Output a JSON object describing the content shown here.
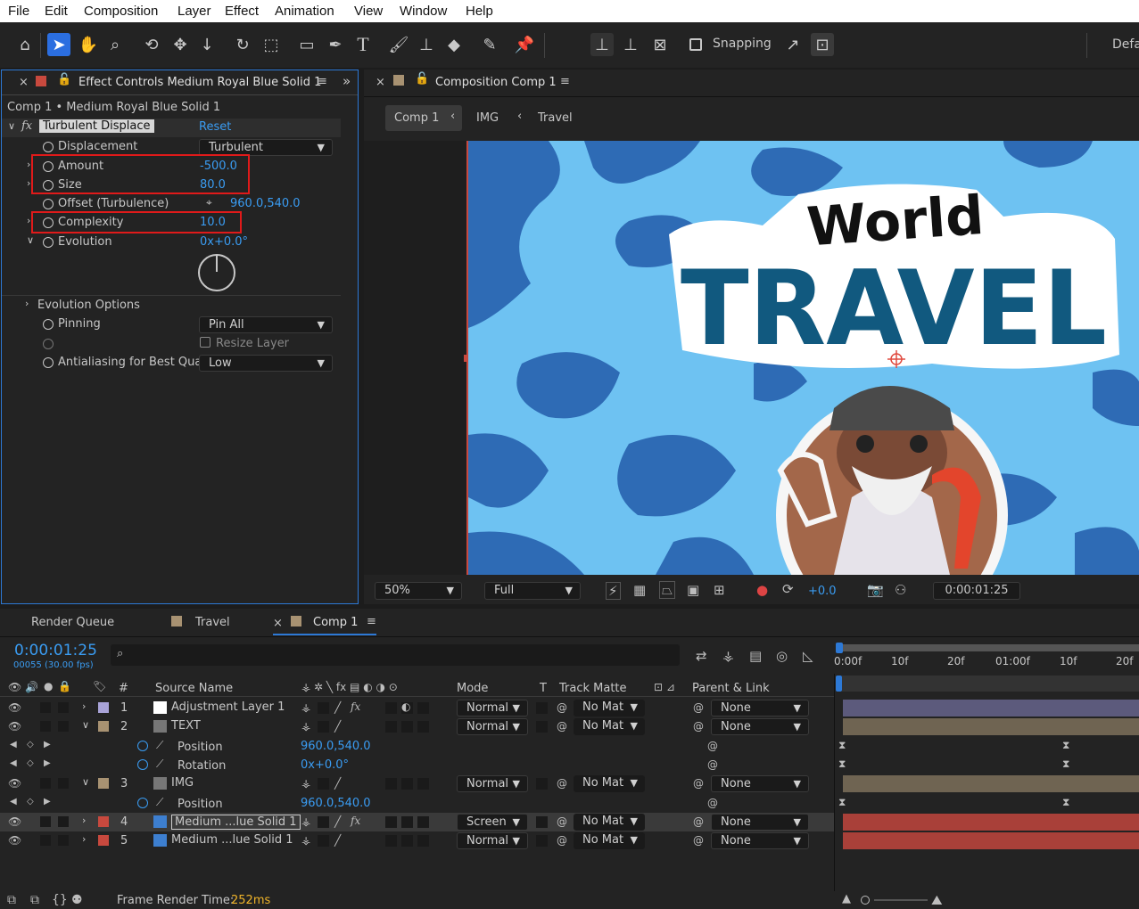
{
  "menu": [
    "File",
    "Edit",
    "Composition",
    "Layer",
    "Effect",
    "Animation",
    "View",
    "Window",
    "Help"
  ],
  "toolbar": {
    "snapping": "Snapping",
    "workspace": "Defa"
  },
  "effect_panel": {
    "tab_title": "Effect Controls Medium Royal Blue Solid 1",
    "breadcrumb": "Comp 1 • Medium Royal Blue Solid 1",
    "effect_name": "Turbulent Displace",
    "reset": "Reset",
    "props": {
      "displacement": {
        "label": "Displacement",
        "value": "Turbulent"
      },
      "amount": {
        "label": "Amount",
        "value": "-500.0"
      },
      "size": {
        "label": "Size",
        "value": "80.0"
      },
      "offset": {
        "label": "Offset (Turbulence)",
        "value": "960.0,540.0"
      },
      "complexity": {
        "label": "Complexity",
        "value": "10.0"
      },
      "evolution": {
        "label": "Evolution",
        "value": "0x+0.0°"
      },
      "evolution_options": {
        "label": "Evolution Options"
      },
      "pinning": {
        "label": "Pinning",
        "value": "Pin All"
      },
      "resize": {
        "label": "Resize Layer"
      },
      "antialias": {
        "label": "Antialiasing for Best Qual",
        "value": "Low"
      }
    }
  },
  "comp_panel": {
    "tab_title": "Composition Comp 1",
    "crumbs": [
      "Comp 1",
      "IMG",
      "Travel"
    ],
    "artwork": {
      "line1": "World",
      "line2": "TRAVEL"
    },
    "zoom": "50%",
    "quality": "Full",
    "exposure": "+0.0",
    "timecode": "0:00:01:25"
  },
  "timeline": {
    "tabs": [
      "Render Queue",
      "Travel",
      "Comp 1"
    ],
    "timecode": "0:00:01:25",
    "frames": "00055 (30.00 fps)",
    "search_placeholder": "",
    "ruler": [
      "0:00f",
      "10f",
      "20f",
      "01:00f",
      "10f",
      "20f"
    ],
    "headers": {
      "num": "#",
      "source": "Source Name",
      "mode": "Mode",
      "t": "T",
      "matte": "Track Matte",
      "parent": "Parent & Link"
    },
    "layers": [
      {
        "num": "1",
        "name": "Adjustment Layer 1",
        "mode": "Normal",
        "matte": "No Mat",
        "parent": "None",
        "color": "#a9a3d8",
        "bar": "#5c5a7c"
      },
      {
        "num": "2",
        "name": "TEXT",
        "mode": "Normal",
        "matte": "No Mat",
        "parent": "None",
        "color": "#a89272",
        "bar": "#6f6452"
      },
      {
        "prop": "Position",
        "value": "960.0,540.0"
      },
      {
        "prop": "Rotation",
        "value": "0x+0.0°"
      },
      {
        "num": "3",
        "name": "IMG",
        "mode": "Normal",
        "matte": "No Mat",
        "parent": "None",
        "color": "#a89272",
        "bar": "#6f6452"
      },
      {
        "prop": "Position",
        "value": "960.0,540.0"
      },
      {
        "num": "4",
        "name": "Medium ...lue Solid 1",
        "mode": "Screen",
        "matte": "No Mat",
        "parent": "None",
        "color": "#c8493e",
        "bar": "#a94039"
      },
      {
        "num": "5",
        "name": "Medium ...lue Solid 1",
        "mode": "Normal",
        "matte": "No Mat",
        "parent": "None",
        "color": "#c8493e",
        "bar": "#a94039"
      }
    ],
    "footer_label": "Frame Render Time:",
    "footer_value": "252ms"
  },
  "colors": {
    "accent": "#3a9cf2",
    "highlight": "#e01a1a",
    "footer_value": "#f0b429",
    "sky": "#6ec2f2",
    "cloud": "#2e6bb5",
    "travel": "#11597f"
  }
}
